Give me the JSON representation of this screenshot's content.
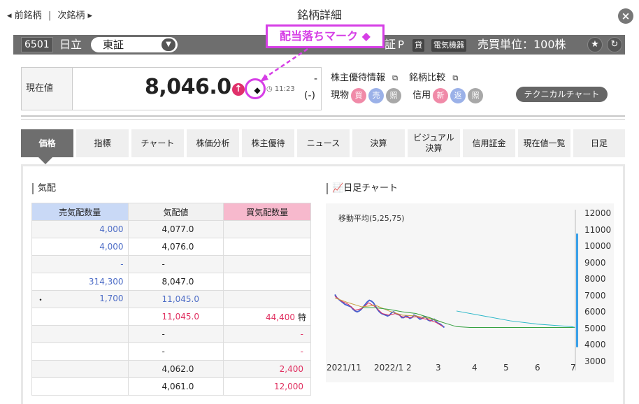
{
  "nav": {
    "prev": "前銘柄",
    "sep": "|",
    "next": "次銘柄"
  },
  "title": "銘柄詳細",
  "header": {
    "code": "6501",
    "name": "日立",
    "market": "東証",
    "market_short": "証",
    "prime": "P",
    "tag_lend": "貸",
    "sector": "電気機器",
    "unit": "売買単位：100株"
  },
  "callout": "配当落ちマーク ◆",
  "price": {
    "label": "現在値",
    "value": "8,046.0",
    "mark": "◆",
    "time": "11:23",
    "change": "-",
    "change_pct": "(-)"
  },
  "links": {
    "yutai": "株主優待情報",
    "compare": "銘柄比較"
  },
  "trade": {
    "spot": "現物",
    "buy": "買",
    "sell": "売",
    "ref": "照",
    "margin": "信用",
    "new": "新",
    "repay": "返",
    "ref2": "照",
    "tech": "テクニカルチャート"
  },
  "tabs": [
    {
      "label": "価格"
    },
    {
      "label": "指標"
    },
    {
      "label": "チャート"
    },
    {
      "label": "株価分析"
    },
    {
      "label": "株主優待"
    },
    {
      "label": "ニュース"
    },
    {
      "label": "決算"
    },
    {
      "label": "ビジュアル決算"
    },
    {
      "label": "信用証金"
    },
    {
      "label": "現在値一覧"
    },
    {
      "label": "日足"
    }
  ],
  "board": {
    "title": "気配",
    "headers": {
      "ask": "売気配数量",
      "price": "気配値",
      "bid": "買気配数量"
    },
    "rows": [
      {
        "lead": "",
        "ask": "4,000",
        "price": "4,077.0",
        "bid": "",
        "flag": "",
        "pc": ""
      },
      {
        "lead": "",
        "ask": "4,000",
        "price": "4,076.0",
        "bid": "",
        "flag": "",
        "pc": ""
      },
      {
        "lead": "",
        "ask": "-",
        "price": "-",
        "bid": "",
        "flag": "",
        "pc": ""
      },
      {
        "lead": "",
        "ask": "314,300",
        "price": "8,047.0",
        "bid": "",
        "flag": "",
        "pc": ""
      },
      {
        "lead": "・",
        "ask": "1,700",
        "price": "11,045.0",
        "bid": "",
        "flag": "",
        "pc": "blue"
      },
      {
        "lead": "",
        "ask": "",
        "price": "11,045.0",
        "bid": "44,400",
        "flag": "特",
        "pc": "red"
      },
      {
        "lead": "",
        "ask": "",
        "price": "-",
        "bid": "-",
        "flag": "",
        "pc": ""
      },
      {
        "lead": "",
        "ask": "",
        "price": "-",
        "bid": "-",
        "flag": "",
        "pc": ""
      },
      {
        "lead": "",
        "ask": "",
        "price": "4,062.0",
        "bid": "2,400",
        "flag": "",
        "pc": ""
      },
      {
        "lead": "",
        "ask": "",
        "price": "4,061.0",
        "bid": "12,000",
        "flag": "",
        "pc": ""
      }
    ]
  },
  "chart_data": {
    "type": "line",
    "title": "日足チャート",
    "legend": "移動平均(5,25,75)",
    "y_ticks": [
      "12000",
      "11000",
      "10000",
      "9000",
      "8000",
      "7000",
      "6000",
      "5000",
      "4000",
      "3000"
    ],
    "ylim": [
      2700,
      12000
    ],
    "x_ticks": [
      "2021/11",
      "2022/1",
      "2",
      "3",
      "4",
      "5",
      "6",
      "7"
    ],
    "series": [
      {
        "name": "price",
        "color": "#4a63d0",
        "x": [
          0,
          3,
          6,
          9,
          12,
          15,
          18,
          21,
          24,
          27,
          30,
          33,
          36,
          39,
          42,
          45,
          48,
          51,
          54,
          57,
          60,
          63,
          66,
          69,
          72,
          75,
          78,
          81,
          84,
          87,
          90,
          93,
          96,
          99,
          102,
          105,
          108,
          111,
          114,
          117,
          120,
          123,
          126,
          129,
          132,
          135,
          138,
          141,
          144,
          147,
          150,
          153,
          156,
          159,
          162
        ],
        "values": [
          7100,
          6900,
          6800,
          6700,
          6600,
          6500,
          6450,
          6400,
          6350,
          6200,
          6100,
          6050,
          6100,
          6200,
          6350,
          6500,
          6650,
          6750,
          6700,
          6600,
          6400,
          6200,
          6050,
          5950,
          5900,
          5850,
          5800,
          5850,
          6000,
          6050,
          5950,
          5900,
          5850,
          5700,
          5700,
          5800,
          5750,
          5650,
          5700,
          5850,
          5800,
          5700,
          5600,
          5650,
          5750,
          5700,
          5550,
          5500,
          5550,
          5600,
          5450,
          5350,
          5300,
          5200,
          5100
        ]
      },
      {
        "name": "ma5",
        "color": "#e03060",
        "x": [
          0,
          10,
          20,
          30,
          40,
          50,
          60,
          70,
          80,
          90,
          100,
          110,
          120,
          130,
          140,
          150,
          160
        ],
        "values": [
          7000,
          6700,
          6500,
          6150,
          6250,
          6600,
          6350,
          5950,
          5850,
          5950,
          5750,
          5700,
          5750,
          5650,
          5550,
          5400,
          5150
        ]
      },
      {
        "name": "ma25",
        "color": "#c8a040",
        "x": [
          0,
          20,
          40,
          60,
          80,
          100,
          120,
          140,
          160
        ],
        "values": [
          6900,
          6600,
          6350,
          6450,
          6100,
          5850,
          5800,
          5650,
          5400
        ]
      },
      {
        "name": "ma75",
        "color": "#35a040",
        "x": [
          40,
          60,
          80,
          100,
          120,
          140,
          160,
          180,
          200,
          260,
          300,
          350,
          356
        ],
        "values": [
          6300,
          6300,
          6200,
          6050,
          5950,
          5700,
          5400,
          5150,
          5100,
          5100,
          5100,
          5100,
          5100
        ]
      },
      {
        "name": "ma_long",
        "color": "#2ab7c8",
        "x": [
          180,
          220,
          260,
          300,
          350,
          356
        ],
        "values": [
          6100,
          5800,
          5500,
          5300,
          5150,
          5100
        ]
      }
    ],
    "last_bar": {
      "x": 356,
      "high": 10800,
      "low": 3900
    },
    "x_domain": [
      0,
      356
    ]
  }
}
